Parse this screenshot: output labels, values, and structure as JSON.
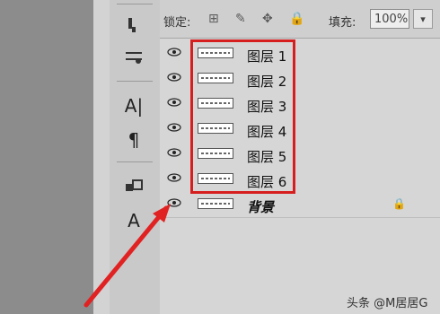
{
  "toolbar": {
    "tools": [
      {
        "name": "paint-bucket-icon",
        "glyph": "♛"
      },
      {
        "name": "brush-icon",
        "glyph": "⚙"
      },
      {
        "name": "type-tool-icon",
        "glyph": "A|"
      },
      {
        "name": "paragraph-icon",
        "glyph": "¶"
      },
      {
        "name": "layer-mask-icon",
        "glyph": "⧉"
      },
      {
        "name": "character-icon",
        "glyph": "A"
      }
    ]
  },
  "layer_panel": {
    "lock_label": "锁定:",
    "fill_label": "填充:",
    "fill_value": "100%",
    "layers": [
      {
        "name": "图层 1"
      },
      {
        "name": "图层 2"
      },
      {
        "name": "图层 3"
      },
      {
        "name": "图层 4"
      },
      {
        "name": "图层 5"
      },
      {
        "name": "图层 6"
      },
      {
        "name": "背景"
      }
    ]
  },
  "watermark": "头条 @M居居G",
  "colors": {
    "highlight": "#d61e1e"
  }
}
